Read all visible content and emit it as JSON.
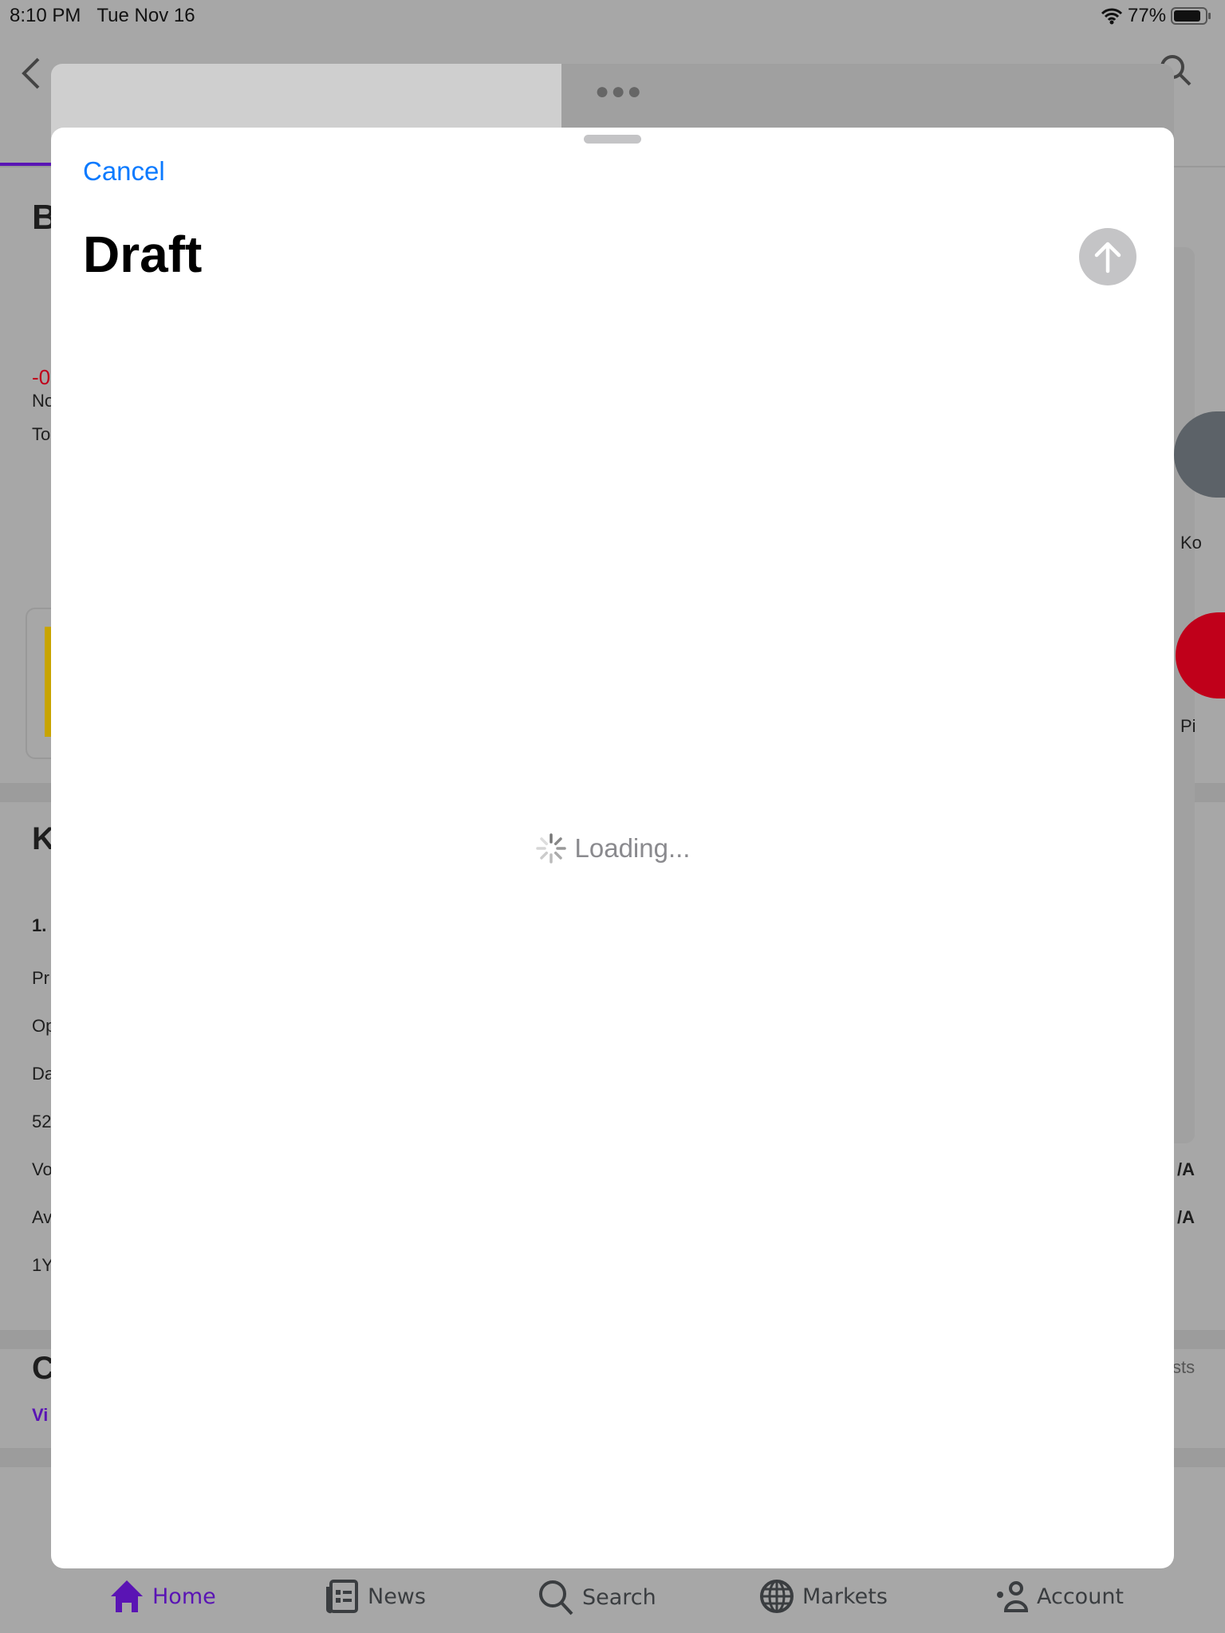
{
  "status_bar": {
    "time": "8:10 PM",
    "date": "Tue Nov 16",
    "battery": "77%"
  },
  "background": {
    "left_fragments": [
      "B",
      "-0",
      "No",
      "To",
      "K",
      "1.",
      "Pr",
      "Op",
      "Da",
      "52",
      "Vo",
      "Av",
      "1Y",
      "C",
      "Vi"
    ],
    "right_fragments": [
      "Ko",
      "Pi",
      "/A",
      "/A",
      "sts"
    ]
  },
  "sheet": {
    "cancel_label": "Cancel",
    "title": "Draft",
    "loading_text": "Loading..."
  },
  "tabbar": {
    "items": [
      {
        "label": "Home",
        "icon": "home-icon",
        "active": true
      },
      {
        "label": "News",
        "icon": "news-icon"
      },
      {
        "label": "Search",
        "icon": "search-icon"
      },
      {
        "label": "Markets",
        "icon": "globe-icon"
      },
      {
        "label": "Account",
        "icon": "account-icon"
      }
    ]
  },
  "colors": {
    "accent": "#0a7aff",
    "brand": "#5a14b4",
    "loss": "#d0021b"
  }
}
